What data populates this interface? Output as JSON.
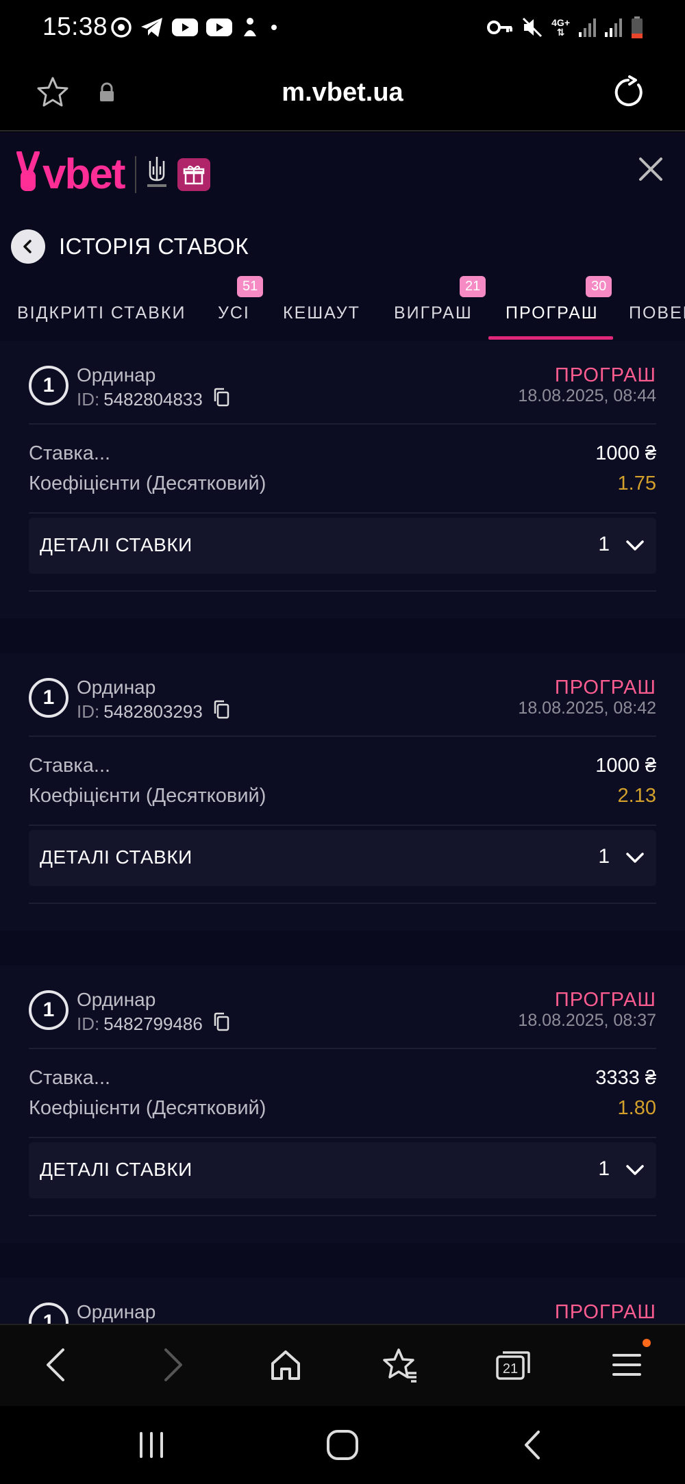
{
  "status_bar": {
    "time": "15:38",
    "network": "4G+",
    "icons_left": [
      "whatsapp-icon",
      "telegram-icon",
      "youtube-icon",
      "youtube-icon",
      "notification-icon"
    ],
    "icons_right": [
      "key-icon",
      "mute-icon",
      "signal-icon",
      "signal-icon",
      "battery-icon"
    ]
  },
  "browser": {
    "url": "m.vbet.ua"
  },
  "site": {
    "logo_text": "vbet",
    "page_title": "ІСТОРІЯ СТАВОК",
    "tabs": [
      {
        "label": "ВІДКРИТІ СТАВКИ",
        "badge": null
      },
      {
        "label": "УСІ",
        "badge": "51"
      },
      {
        "label": "КЕШАУТ",
        "badge": null
      },
      {
        "label": "ВИГРАШ",
        "badge": "21"
      },
      {
        "label": "ПРОГРАШ",
        "badge": "30"
      },
      {
        "label": "ПОВЕР",
        "badge": null
      }
    ],
    "active_tab": "ПРОГРАШ"
  },
  "bets": [
    {
      "number": "1",
      "type": "Ординар",
      "id_label": "ID:",
      "id": "5482804833",
      "status": "ПРОГРАШ",
      "date": "18.08.2025, 08:44",
      "stake_label": "Ставка...",
      "stake": "1000 ₴",
      "odds_label": "Коефіцієнти (Десятковий)",
      "odds": "1.75",
      "details_label": "ДЕТАЛІ СТАВКИ",
      "details_count": "1"
    },
    {
      "number": "1",
      "type": "Ординар",
      "id_label": "ID:",
      "id": "5482803293",
      "status": "ПРОГРАШ",
      "date": "18.08.2025, 08:42",
      "stake_label": "Ставка...",
      "stake": "1000 ₴",
      "odds_label": "Коефіцієнти (Десятковий)",
      "odds": "2.13",
      "details_label": "ДЕТАЛІ СТАВКИ",
      "details_count": "1"
    },
    {
      "number": "1",
      "type": "Ординар",
      "id_label": "ID:",
      "id": "5482799486",
      "status": "ПРОГРАШ",
      "date": "18.08.2025, 08:37",
      "stake_label": "Ставка...",
      "stake": "3333 ₴",
      "odds_label": "Коефіцієнти (Десятковий)",
      "odds": "1.80",
      "details_label": "ДЕТАЛІ СТАВКИ",
      "details_count": "1"
    },
    {
      "number": "1",
      "type": "Ординар",
      "status": "ПРОГРАШ"
    }
  ],
  "browser_nav": {
    "tabs_count": "21"
  },
  "colors": {
    "brand_pink": "#ff2d96",
    "status_lost": "#ff5d8f",
    "odds_gold": "#d2a02b",
    "tab_badge": "#f58ac4",
    "active_underline": "#e0287a",
    "page_bg": "#0a0a1f"
  }
}
